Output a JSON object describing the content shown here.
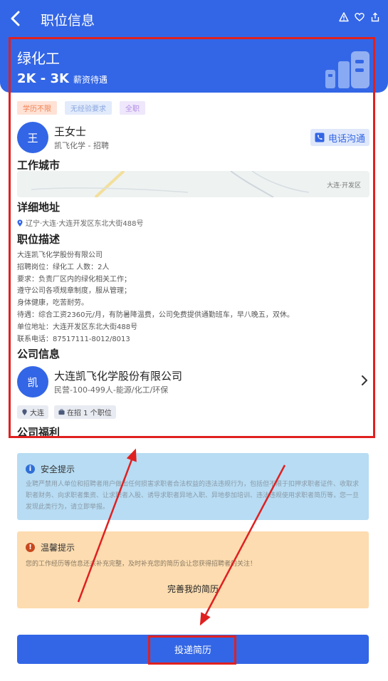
{
  "header": {
    "title": "职位信息",
    "job_title": "绿化工",
    "salary": "2K - 3K",
    "salary_label": "薪资待遇"
  },
  "tags": [
    "学历不限",
    "无经验要求",
    "全职"
  ],
  "contact": {
    "avatar": "王",
    "name": "王女士",
    "role": "凯飞化学 - 招聘",
    "call_label": "电话沟通"
  },
  "sections": {
    "city": "工作城市",
    "address": "详细地址",
    "description": "职位描述",
    "company": "公司信息",
    "welfare": "公司福利"
  },
  "map_label": "大连·开发区",
  "address": "辽宁·大连·大连开发区东北大街488号",
  "description_lines": [
    "大连凯飞化学股份有限公司",
    "招聘岗位：绿化工    人数：2人",
    "要求：负责厂区内的绿化相关工作；",
    "遵守公司各项规章制度，服从管理；",
    "身体健康，吃苦耐劳。",
    "待遇：综合工资2360元/月，有防暑降温费，公司免费提供通勤班车，早八晚五，双休。",
    "单位地址：大连开发区东北大街488号",
    "联系电话：87517111-8012/8013"
  ],
  "company": {
    "avatar": "凯",
    "name": "大连凯飞化学股份有限公司",
    "meta": "民营-100-499人-能源/化工/环保",
    "tag_city": "大连",
    "tag_jobs": "在招 1 个职位"
  },
  "safety": {
    "title": "安全提示",
    "body": "业聘严禁用人单位和招聘者用户做出任何损害求职者合法权益的违法违规行为，包括但不限于扣押求职者证件、收取求职者财务、向求职者集资、让求职者入股、诱导求职者异地入职、异地参加培训、违法违规使用求职者简历等，您一旦发现此类行为，请立即举报。"
  },
  "tip": {
    "title": "温馨提示",
    "body": "您的工作经历等信息还未补充完整，及时补充您的简历会让您获得招聘者的关注！",
    "button": "完善我的简历"
  },
  "apply_label": "投递简历",
  "colors": {
    "primary": "#3366e6",
    "annotation": "#e02020"
  }
}
